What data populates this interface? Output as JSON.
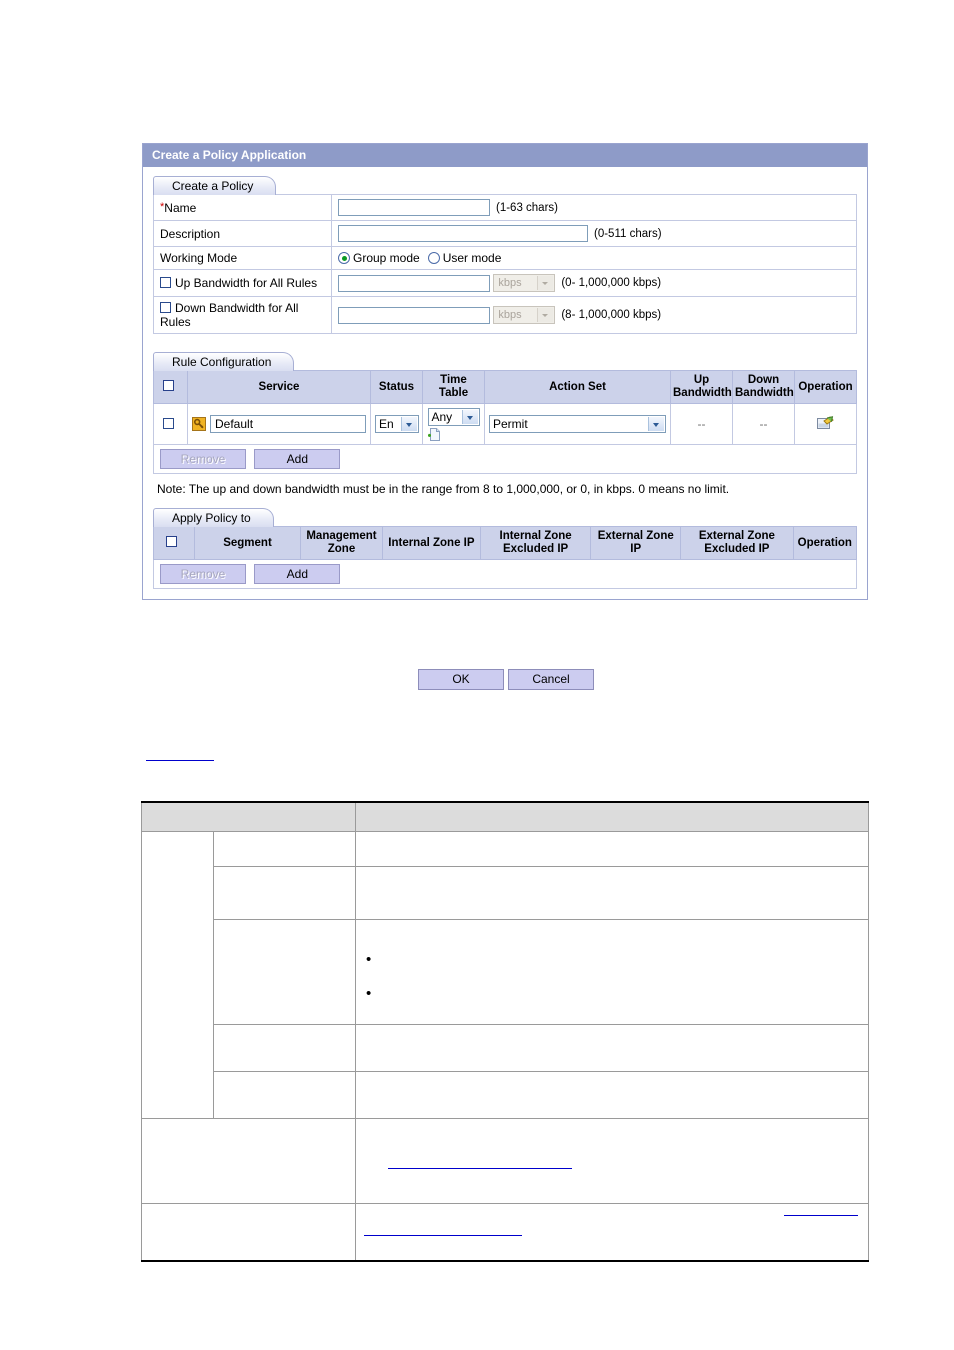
{
  "dialog": {
    "title": "Create a Policy Application",
    "tabs": {
      "create_policy": "Create a Policy",
      "rule_configuration": "Rule Configuration",
      "apply_policy_to": "Apply Policy to"
    },
    "form": {
      "required_marker": "*",
      "rows": [
        {
          "label": "Name",
          "value": "",
          "hint": "(1-63  chars)"
        },
        {
          "label": "Description",
          "value": "",
          "hint": "(0-511  chars)"
        },
        {
          "label": "Working Mode",
          "hint": ""
        },
        {
          "label": "Up Bandwidth for All Rules",
          "value": "",
          "unit": "kbps",
          "hint": "(0- 1,000,000  kbps)"
        },
        {
          "label": "Down Bandwidth for All Rules",
          "value": "",
          "unit": "kbps",
          "hint": "(8- 1,000,000  kbps)"
        }
      ],
      "working_mode": {
        "group_mode": "Group mode",
        "user_mode": "User mode",
        "selected": "Group mode"
      }
    },
    "rule_table": {
      "headers": [
        "",
        "Service",
        "Status",
        "Time Table",
        "Action Set",
        "Up Bandwidth",
        "Down Bandwidth",
        "Operation"
      ],
      "header_up_bandwidth_line1": "Up",
      "header_up_bandwidth_line2": "Bandwidth",
      "header_down_bandwidth_line1": "Down",
      "header_down_bandwidth_line2": "Bandwidth",
      "rows": [
        {
          "service": "Default",
          "status": "En",
          "time_table": "Any",
          "action_set": "Permit",
          "up_bandwidth": "--",
          "down_bandwidth": "--"
        }
      ],
      "buttons": {
        "remove": "Remove",
        "add": "Add"
      }
    },
    "note": "Note: The up and down bandwidth must be in the range from 8 to 1,000,000, or 0, in kbps. 0 means no limit.",
    "apply_table": {
      "headers": [
        "",
        "Segment",
        "Management Zone",
        "Internal Zone IP",
        "Internal Zone Excluded IP",
        "External Zone IP",
        "External Zone Excluded IP",
        "Operation"
      ],
      "header_management_zone_line1": "Management",
      "header_management_zone_line2": "Zone",
      "header_internal_zone_ip": "Internal Zone IP",
      "header_internal_excluded_line1": "Internal Zone",
      "header_internal_excluded_line2": "Excluded IP",
      "header_external_ip_line1": "External Zone",
      "header_external_ip_line2": "IP",
      "header_external_excluded_line1": "External Zone",
      "header_external_excluded_line2": "Excluded IP",
      "header_segment": "Segment",
      "header_operation": "Operation",
      "buttons": {
        "remove": "Remove",
        "add": "Add"
      }
    },
    "footer": {
      "ok": "OK",
      "cancel": "Cancel"
    }
  },
  "colors": {
    "title_bar": "#8e9bc8",
    "table_header": "#ccd2ea",
    "button_face": "#ccccf0",
    "link": "#0000cc",
    "required_star": "#d00000",
    "radio_dot": "#0a9a24"
  }
}
